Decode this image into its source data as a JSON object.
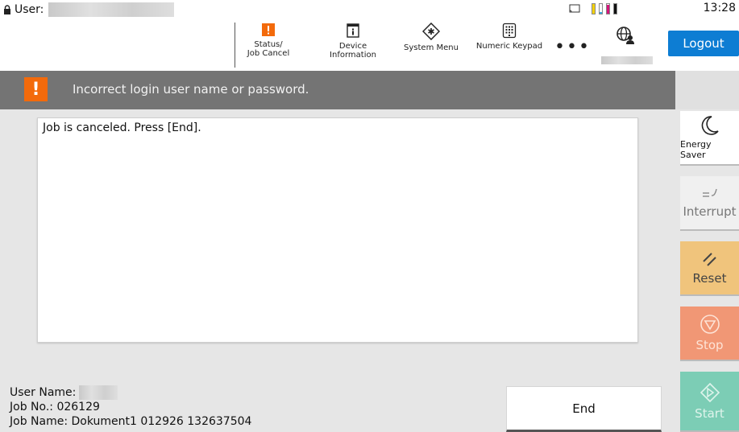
{
  "status_bar": {
    "user_label": "User:",
    "time": "13:28",
    "ink_levels": [
      {
        "color": "#f2d10b",
        "level": 1.0
      },
      {
        "color": "#38a9e0",
        "level": 0.2
      },
      {
        "color": "#d4147a",
        "level": 0.9
      },
      {
        "color": "#111111",
        "level": 1.0
      }
    ]
  },
  "toolbar": {
    "status_label_1": "Status/",
    "status_label_2": "Job Cancel",
    "device_label_1": "Device",
    "device_label_2": "Information",
    "system_menu_label": "System Menu",
    "keypad_label": "Numeric Keypad",
    "more_label": "•••",
    "logout_label": "Logout",
    "accent_color": "#0d7dd3",
    "status_icon_color": "#f36a0b"
  },
  "message": {
    "icon": "!",
    "text": "Incorrect login user name or password."
  },
  "panel": {
    "text": "Job is canceled. Press [End]."
  },
  "job_info": {
    "user_name_label": "User Name:",
    "job_no": "Job No.: 026129",
    "job_name": "Job Name: Dokument1 012926 132637504"
  },
  "end_button": "End",
  "side_buttons": {
    "energy_saver": "Energy Saver",
    "interrupt": "Interrupt",
    "reset": "Reset",
    "stop": "Stop",
    "start": "Start"
  }
}
